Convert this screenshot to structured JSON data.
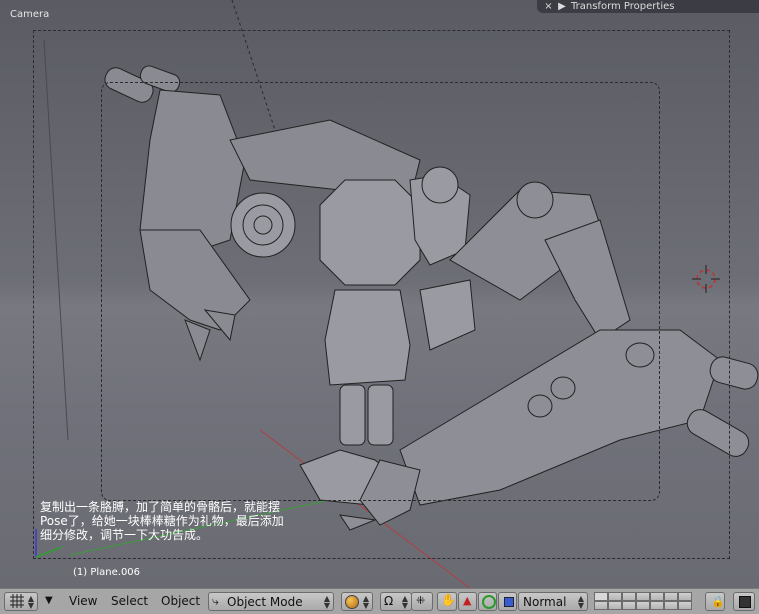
{
  "viewport": {
    "camera_label": "Camera",
    "object_name": "(1) Plane.006",
    "annotation": "复制出一条胳膊，加了简单的骨骼后，就能摆\nPose了，给她一块棒棒糖作为礼物，最后添加\n细分修改，调节一下大功告成。"
  },
  "transform_panel": {
    "title": "Transform Properties",
    "close_glyph": "×",
    "collapse_glyph": "▶"
  },
  "header": {
    "view_menu": "View",
    "select_menu": "Select",
    "object_menu": "Object",
    "mode_select": "Object Mode",
    "draw_type": "Normal"
  },
  "icons": {
    "editor_type": "grid-icon",
    "menu_toggle": "triangle-down-icon",
    "mode": "object-mode-icon",
    "shading": "solid-sphere-icon",
    "pivot": "pivot-icon",
    "snap": "snap-icon",
    "hand": "hand-icon",
    "translate": "triangle-icon",
    "rotate": "ring-icon",
    "scale": "square-icon",
    "lock": "lock-icon",
    "render": "render-icon"
  },
  "colors": {
    "header_bg": "#a6a6a6",
    "viewport_bg": "#6d6e76",
    "panel_header": "#3c3c44"
  }
}
